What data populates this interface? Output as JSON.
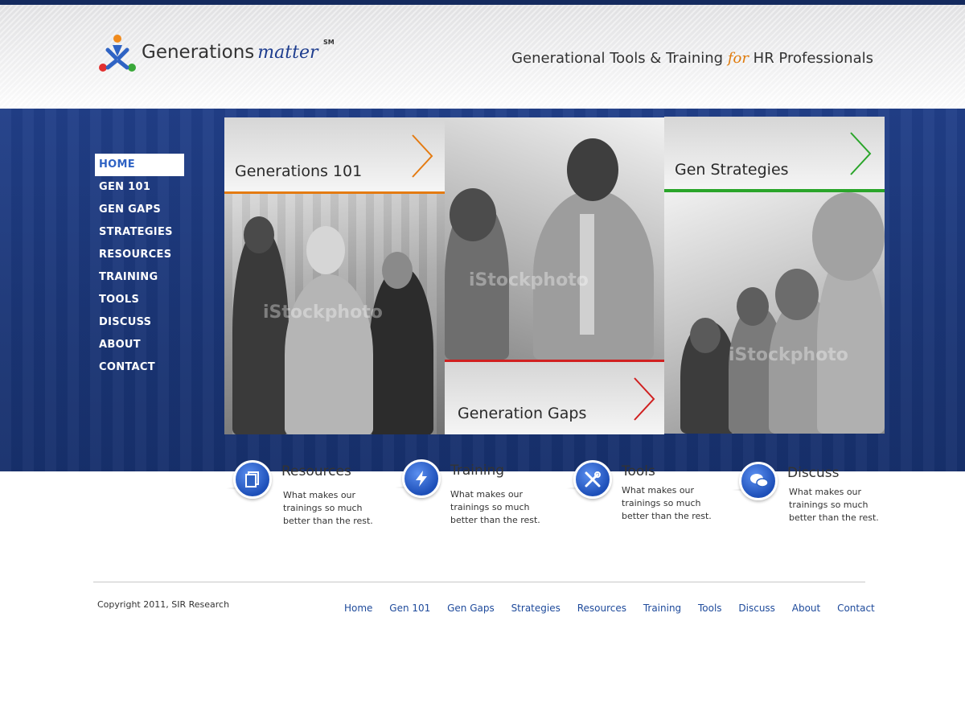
{
  "brand": {
    "name": "Generations",
    "name_script": "matter",
    "service_mark": "SM",
    "tagline_part1": "Generational Tools & Training",
    "tagline_for": "for",
    "tagline_part2": "HR Professionals"
  },
  "nav": {
    "items": [
      {
        "label": "HOME",
        "active": true
      },
      {
        "label": "GEN 101"
      },
      {
        "label": "GEN GAPS"
      },
      {
        "label": "STRATEGIES"
      },
      {
        "label": "RESOURCES"
      },
      {
        "label": "TRAINING"
      },
      {
        "label": "TOOLS"
      },
      {
        "label": "DISCUSS"
      },
      {
        "label": "ABOUT"
      },
      {
        "label": "CONTACT"
      }
    ]
  },
  "tiles": {
    "gen101": {
      "title": "Generations 101",
      "accent": "#e47b12"
    },
    "gengaps": {
      "title": "Generation Gaps",
      "accent": "#d02020"
    },
    "genstrategies": {
      "title": "Gen Strategies",
      "accent": "#2aa52a"
    },
    "watermark": "iStockphoto"
  },
  "features": [
    {
      "title": "Resources",
      "desc": "What makes our trainings so much better than the rest.",
      "icon": "document-icon"
    },
    {
      "title": "Training",
      "desc": "What makes our trainings so much better than the rest.",
      "icon": "lightning-icon"
    },
    {
      "title": "Tools",
      "desc": "What makes our trainings so much better than the rest.",
      "icon": "tools-icon"
    },
    {
      "title": "Discuss",
      "desc": "What makes our trainings so much better than the rest.",
      "icon": "chat-bubbles-icon"
    }
  ],
  "footer": {
    "copyright": "Copyright 2011, SIR Research",
    "links": [
      "Home",
      "Gen 101",
      "Gen Gaps",
      "Strategies",
      "Resources",
      "Training",
      "Tools",
      "Discuss",
      "About",
      "Contact"
    ]
  },
  "colors": {
    "navy": "#142a5e",
    "band": "#1b3677",
    "link": "#1e4a9b"
  }
}
